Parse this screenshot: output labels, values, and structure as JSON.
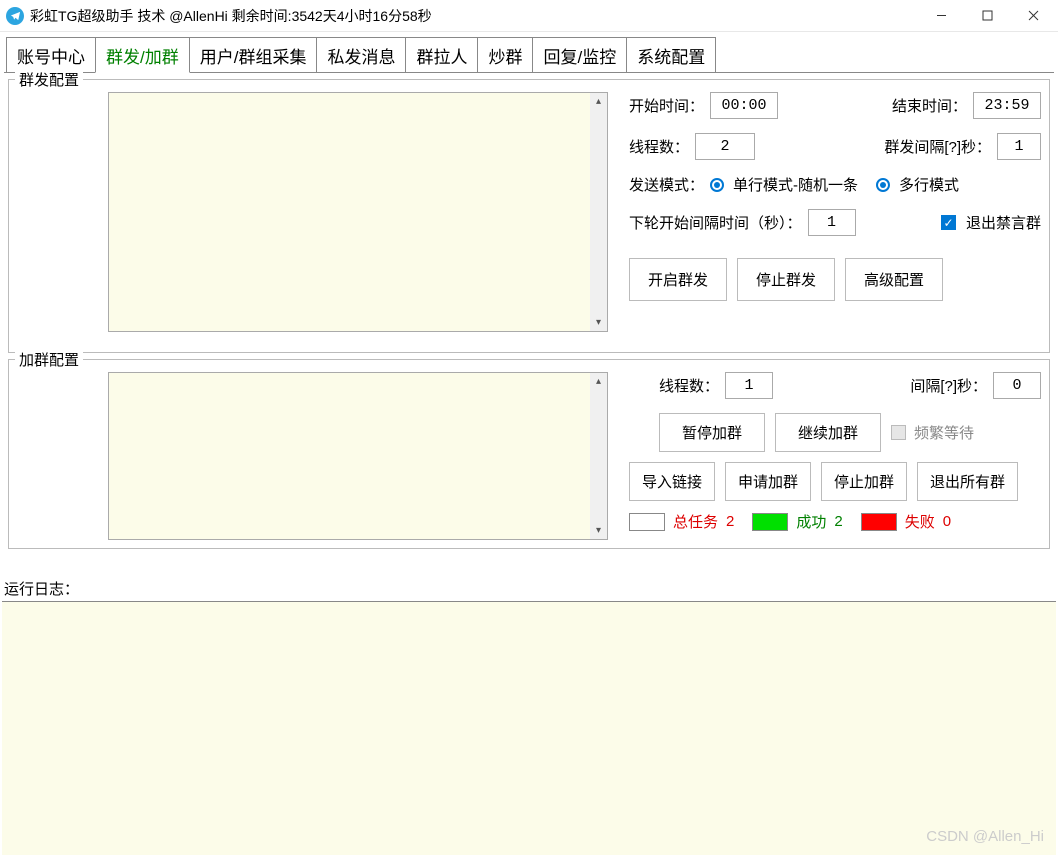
{
  "title": "彩虹TG超级助手 技术 @AllenHi 剩余时间:3542天4小时16分58秒",
  "tabs": [
    "账号中心",
    "群发/加群",
    "用户/群组采集",
    "私发消息",
    "群拉人",
    "炒群",
    "回复/监控",
    "系统配置"
  ],
  "box1": {
    "legend": "群发配置",
    "start_time_label": "开始时间：",
    "start_time_value": "00:00",
    "end_time_label": "结束时间：",
    "end_time_value": "23:59",
    "threads_label": "线程数：",
    "threads_value": "2",
    "interval_label": "群发间隔[?]秒：",
    "interval_value": "1",
    "mode_label": "发送模式：",
    "mode_single": "单行模式-随机一条",
    "mode_multi": "多行模式",
    "next_round_label": "下轮开始间隔时间（秒）：",
    "next_round_value": "1",
    "exit_mute_label": "退出禁言群",
    "btn_start": "开启群发",
    "btn_stop": "停止群发",
    "btn_adv": "高级配置"
  },
  "box2": {
    "legend": "加群配置",
    "threads_label": "线程数：",
    "threads_value": "1",
    "interval_label": "间隔[?]秒：",
    "interval_value": "0",
    "btn_pause": "暂停加群",
    "btn_continue": "继续加群",
    "freq_wait_label": "频繁等待",
    "btn_import": "导入链接",
    "btn_apply": "申请加群",
    "btn_stop": "停止加群",
    "btn_exit_all": "退出所有群",
    "total_label": "总任务",
    "total_value": "2",
    "success_label": "成功",
    "success_value": "2",
    "fail_label": "失败",
    "fail_value": "0"
  },
  "log_label": "运行日志：",
  "watermark": "CSDN @Allen_Hi"
}
